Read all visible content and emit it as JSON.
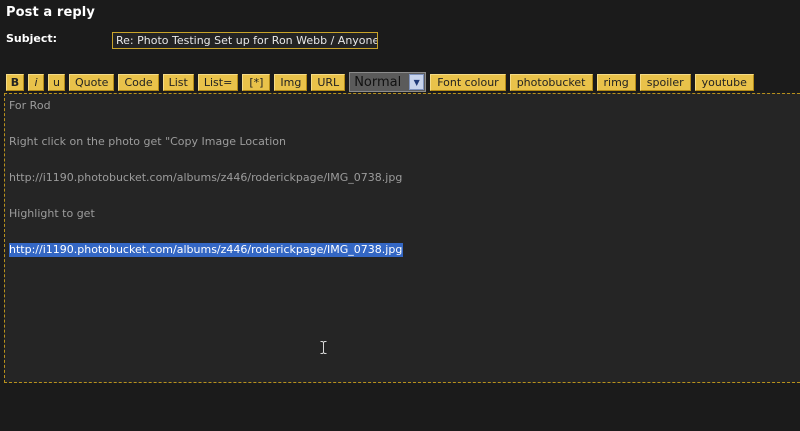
{
  "page": {
    "heading": "Post a reply"
  },
  "subject": {
    "label": "Subject:",
    "value": "Re: Photo Testing Set up for Ron Webb / Anyone"
  },
  "toolbar": {
    "bold": "B",
    "italic": "i",
    "underline": "u",
    "quote": "Quote",
    "code": "Code",
    "list": "List",
    "list_ordered": "List=",
    "list_item": "[*]",
    "img": "Img",
    "url": "URL",
    "font_size": "Normal",
    "font_colour": "Font colour",
    "photobucket": "photobucket",
    "rimg": "rimg",
    "spoiler": "spoiler",
    "youtube": "youtube"
  },
  "editor": {
    "lines": [
      "For Rod",
      "Right click on the photo get \"Copy Image Location",
      "http://i1190.photobucket.com/albums/z446/roderickpage/IMG_0738.jpg",
      "Highlight to get",
      "http://i1190.photobucket.com/albums/z446/roderickpage/IMG_0738.jpg"
    ]
  },
  "colors": {
    "background": "#1b1b1b",
    "button": "#e9c24a",
    "selection": "#3467c4",
    "border_accent": "#b8911c"
  }
}
